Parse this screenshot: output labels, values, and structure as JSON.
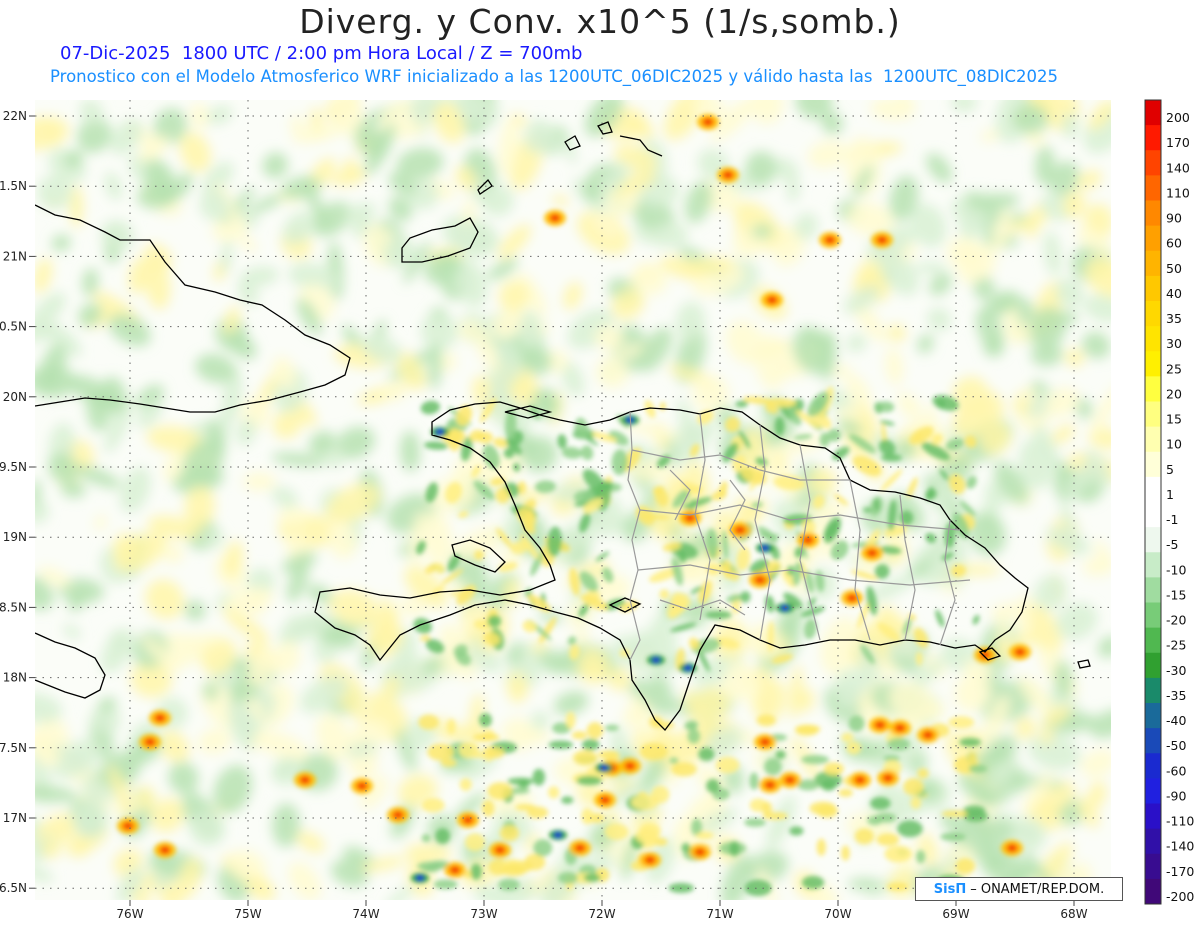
{
  "header": {
    "title": "Diverg. y Conv. x10^5 (1/s,somb.)",
    "date_line": "07-Dic-2025  1800 UTC / 2:00 pm Hora Local / Z = 700mb",
    "model_line": "Pronostico con el Modelo Atmosferico WRF inicializado a las 1200UTC_06DIC2025 y válido hasta las  1200UTC_08DIC2025"
  },
  "map": {
    "lat_labels": [
      "22N",
      "1.5N",
      "21N",
      "0.5N",
      "20N",
      "9.5N",
      "19N",
      "8.5N",
      "18N",
      "7.5N",
      "17N",
      "6.5N"
    ],
    "lon_labels": [
      "76W",
      "75W",
      "74W",
      "73W",
      "72W",
      "71W",
      "70W",
      "69W",
      "68W"
    ],
    "colors": {
      "coastline": "#000000",
      "provinces": "#a0a0a0",
      "grid": "#666666"
    }
  },
  "colorbar": {
    "levels": [
      "200",
      "170",
      "140",
      "110",
      "90",
      "60",
      "50",
      "40",
      "35",
      "30",
      "25",
      "20",
      "15",
      "10",
      "5",
      "1",
      "-1",
      "-5",
      "-10",
      "-15",
      "-20",
      "-25",
      "-30",
      "-35",
      "-40",
      "-50",
      "-60",
      "-90",
      "-110",
      "-140",
      "-170",
      "-200"
    ],
    "colors": [
      "#e00000",
      "#ff1a00",
      "#ff4400",
      "#ff6600",
      "#ff8800",
      "#ffa000",
      "#ffb400",
      "#ffc800",
      "#ffd800",
      "#ffe400",
      "#fff000",
      "#ffff40",
      "#ffff80",
      "#ffffb0",
      "#ffffd8",
      "#ffffff",
      "#ffffff",
      "#eef8ee",
      "#c8ecc8",
      "#a0dca0",
      "#78cc78",
      "#50b850",
      "#30a030",
      "#1a8a6a",
      "#1a6a9a",
      "#1a4ab8",
      "#1a2ad0",
      "#2020e0",
      "#2a10c8",
      "#3010a8",
      "#380c90",
      "#400878"
    ]
  },
  "credit": {
    "logo": "SisΠ",
    "text": "– ONAMET/REP.DOM."
  }
}
